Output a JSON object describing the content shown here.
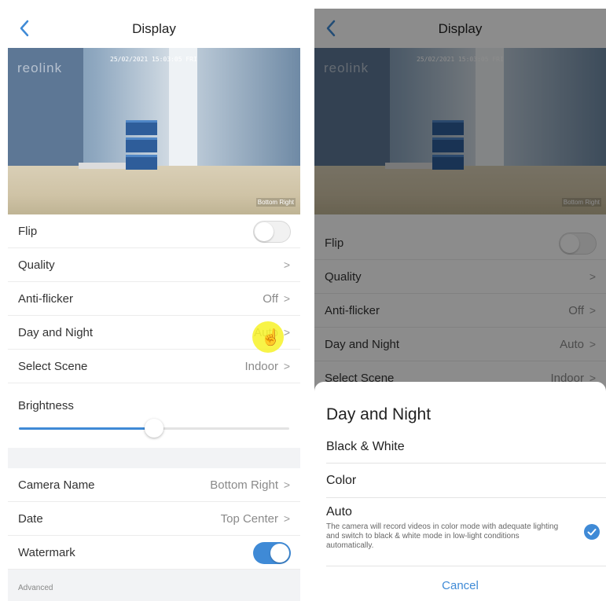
{
  "colors": {
    "accent": "#3f8ad6",
    "highlight": "#f7f228"
  },
  "icons": {
    "back": "chevron-left-icon",
    "chevron": "chevron-right-icon",
    "check": "checkmark-icon",
    "cursor": "hand-pointer-icon"
  },
  "header": {
    "title": "Display"
  },
  "video": {
    "brand": "reolink",
    "timestamp": "25/02/2021 15:03:05 FRI",
    "camera_label": "Bottom Right"
  },
  "settings": {
    "flip": {
      "label": "Flip",
      "enabled": false
    },
    "quality": {
      "label": "Quality",
      "value": "",
      "chevron": ">"
    },
    "anti_flicker": {
      "label": "Anti-flicker",
      "value": "Off",
      "chevron": ">"
    },
    "day_night": {
      "label": "Day and Night",
      "value": "Auto",
      "chevron": ">"
    },
    "scene": {
      "label": "Select Scene",
      "value": "Indoor",
      "chevron": ">"
    },
    "brightness": {
      "label": "Brightness",
      "level": 0.5
    },
    "camera_name": {
      "label": "Camera Name",
      "value": "Bottom Right",
      "chevron": ">"
    },
    "date": {
      "label": "Date",
      "value": "Top Center",
      "chevron": ">"
    },
    "watermark": {
      "label": "Watermark",
      "enabled": true
    },
    "advanced": "Advanced"
  },
  "sheet": {
    "title": "Day and Night",
    "options": [
      {
        "label": "Black & White"
      },
      {
        "label": "Color"
      },
      {
        "label": "Auto",
        "description": "The camera will record videos in color mode with adequate lighting and switch to black & white mode in low-light conditions automatically.",
        "selected": true
      }
    ],
    "cancel": "Cancel"
  }
}
